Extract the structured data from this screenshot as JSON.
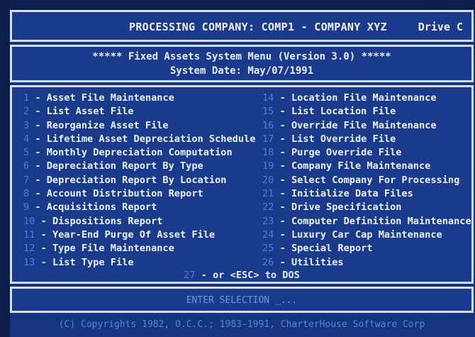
{
  "header": {
    "title": "PROCESSING COMPANY: COMP1 - COMPANY XYZ",
    "drive": "Drive C"
  },
  "menu_header": {
    "title": "***** Fixed Assets System Menu (Version 3.0) *****",
    "system_date": "System Date: May/07/1991"
  },
  "menu": {
    "left": [
      {
        "num": "1",
        "label": "Asset File Maintenance"
      },
      {
        "num": "2",
        "label": "List Asset File"
      },
      {
        "num": "3",
        "label": "Reorganize Asset File"
      },
      {
        "num": "4",
        "label": "Lifetime Asset Depreciation Schedule"
      },
      {
        "num": "5",
        "label": "Monthly Depreciation Computation"
      },
      {
        "num": "6",
        "label": "Depreciation Report By Type"
      },
      {
        "num": "7",
        "label": "Depreciation Report By Location"
      },
      {
        "num": "8",
        "label": "Account Distribution Report"
      },
      {
        "num": "9",
        "label": "Acquisitions Report"
      },
      {
        "num": "10",
        "label": "Dispositions Report"
      },
      {
        "num": "11",
        "label": "Year-End Purge Of Asset File"
      },
      {
        "num": "12",
        "label": "Type File Maintenance"
      },
      {
        "num": "13",
        "label": "List Type File"
      }
    ],
    "right": [
      {
        "num": "14",
        "label": "Location File Maintenance"
      },
      {
        "num": "15",
        "label": "List Location File"
      },
      {
        "num": "16",
        "label": "Override File Maintenance"
      },
      {
        "num": "17",
        "label": "List Override File"
      },
      {
        "num": "18",
        "label": "Purge Override File"
      },
      {
        "num": "19",
        "label": "Company File Maintenance"
      },
      {
        "num": "20",
        "label": "Select Company For Processing"
      },
      {
        "num": "21",
        "label": "Initialize Data Files"
      },
      {
        "num": "22",
        "label": "Drive Specification"
      },
      {
        "num": "23",
        "label": "Computer Definition Maintenance"
      },
      {
        "num": "24",
        "label": "Luxury Car Cap Maintenance"
      },
      {
        "num": "25",
        "label": "Special Report"
      },
      {
        "num": "26",
        "label": "Utilities"
      }
    ],
    "exit": {
      "num": "27",
      "label": "or <ESC> to DOS"
    }
  },
  "entry": {
    "prompt": "ENTER SELECTION",
    "cursor": "_..."
  },
  "footer": {
    "copyright": "(C) Copyrights 1982, O.C.C.; 1983-1991, CharterHouse Software Corp"
  }
}
